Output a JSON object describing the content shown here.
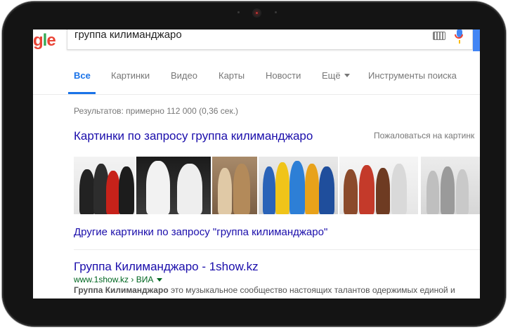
{
  "search": {
    "query": "группа килиманджаро"
  },
  "logo": {
    "text_g": "g",
    "text_l": "l",
    "text_e": "e"
  },
  "tabs": [
    {
      "label": "Все"
    },
    {
      "label": "Картинки"
    },
    {
      "label": "Видео"
    },
    {
      "label": "Карты"
    },
    {
      "label": "Новости"
    },
    {
      "label": "Ещё"
    },
    {
      "label": "Инструменты поиска"
    }
  ],
  "results_count": "Результатов: примерно 112 000 (0,36 сек.)",
  "images_section": {
    "heading": "Картинки по запросу группа килиманджаро",
    "complain": "Пожаловаться на картинк",
    "more_link": "Другие картинки по запросу \"группа килиманджаро\""
  },
  "result": {
    "title": "Группа Килиманджаро - 1show.kz",
    "url": "www.1show.kz › ВИА",
    "snippet_bold": "Группа Килиманджаро",
    "snippet_rest": " это музыкальное сообщество настоящих талантов одержимых единой и"
  },
  "colors": {
    "link": "#1a0dab",
    "url": "#006621",
    "accent": "#1a73e8",
    "text_muted": "#777777"
  },
  "icons": [
    "keyboard-icon",
    "microphone-icon",
    "camera-icon",
    "chevron-down-icon"
  ]
}
